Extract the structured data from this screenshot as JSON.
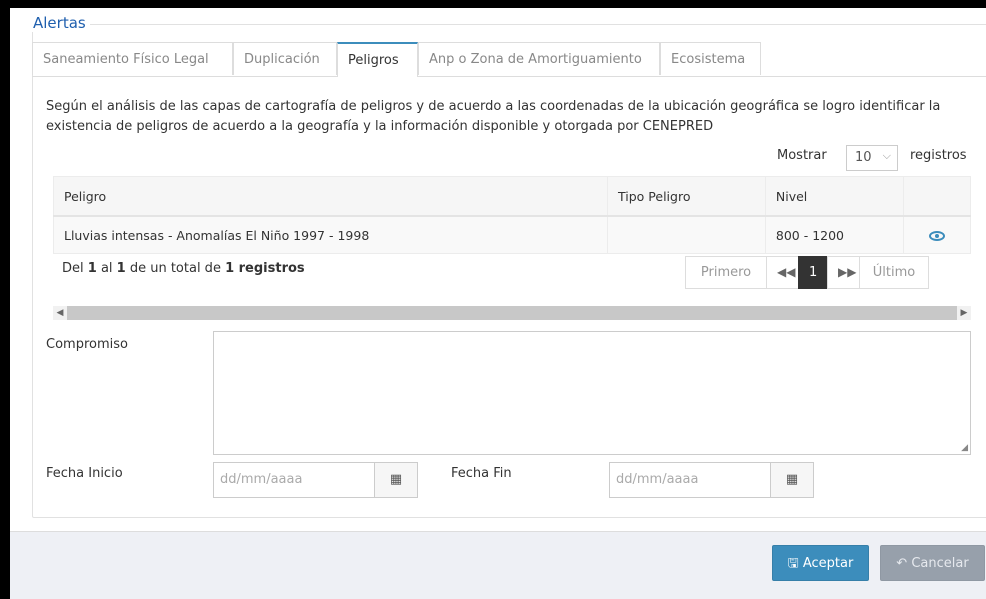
{
  "section": {
    "legend": "Alertas"
  },
  "tabs": [
    {
      "label": "Saneamiento Físico Legal"
    },
    {
      "label": "Duplicación"
    },
    {
      "label": "Peligros"
    },
    {
      "label": "Anp o Zona de Amortiguamiento"
    },
    {
      "label": "Ecosistema"
    }
  ],
  "intro": {
    "text": "Según el análisis de las capas de cartografía de peligros y de acuerdo a las coordenadas de la ubicación geográfica se logro identificar la existencia de peligros de acuerdo a la geografía y la información disponible y otorgada por CENEPRED"
  },
  "length": {
    "prefix": "Mostrar",
    "value": "10",
    "suffix": "registros"
  },
  "table": {
    "headers": [
      "Peligro",
      "Tipo Peligro",
      "Nivel",
      ""
    ],
    "rows": [
      {
        "peligro": "Lluvias intensas - Anomalías El Niño 1997 - 1998",
        "tipo": "",
        "nivel": "800 - 1200",
        "action_icon": "eye-icon"
      }
    ]
  },
  "info": {
    "t1": "Del ",
    "from": "1",
    "t2": " al ",
    "to": "1",
    "t3": " de un total de ",
    "total": "1 registros"
  },
  "pager": {
    "first": "Primero",
    "prev": "◀◀",
    "current": "1",
    "next": "▶▶",
    "last": "Último"
  },
  "form": {
    "compromiso_label": "Compromiso",
    "fecha_inicio_label": "Fecha Inicio",
    "fecha_inicio_placeholder": "dd/mm/aaaa",
    "fecha_fin_label": "Fecha Fin",
    "fecha_fin_placeholder": "dd/mm/aaaa"
  },
  "buttons": {
    "aceptar": "Aceptar",
    "cancelar": "Cancelar"
  },
  "colors": {
    "primary": "#3c8dbc",
    "legend": "#1f5fae",
    "footer": "#eef0f5"
  }
}
